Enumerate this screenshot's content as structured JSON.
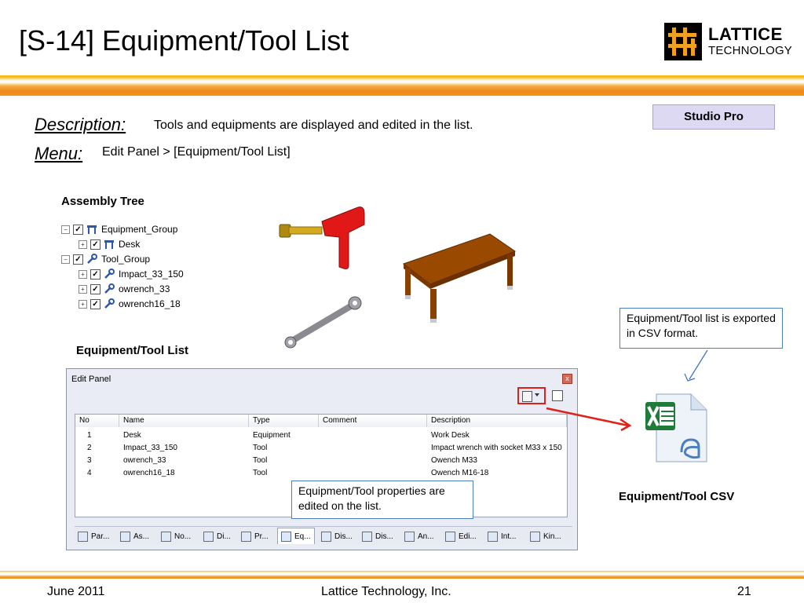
{
  "slide": {
    "title": "[S-14] Equipment/Tool List",
    "logo": {
      "word1": "LATTICE",
      "word2": "TECHNOLOGY"
    },
    "badge": "Studio Pro",
    "description_label": "Description:",
    "description_text": "Tools and equipments are displayed and edited in the list.",
    "menu_label": "Menu:",
    "menu_text": "Edit Panel > [Equipment/Tool List]"
  },
  "assembly_tree": {
    "caption": "Assembly Tree",
    "nodes": [
      {
        "label": "Equipment_Group",
        "icon": "group-icon"
      },
      {
        "label": "Desk",
        "icon": "group-icon"
      },
      {
        "label": "Tool_Group",
        "icon": "wrench-icon"
      },
      {
        "label": "Impact_33_150",
        "icon": "wrench-icon"
      },
      {
        "label": "owrench_33",
        "icon": "wrench-icon"
      },
      {
        "label": "owrench16_18",
        "icon": "wrench-icon"
      }
    ]
  },
  "list_caption": "Equipment/Tool List",
  "edit_panel": {
    "title": "Edit Panel",
    "close_glyph": "x",
    "columns": [
      "No",
      "Name",
      "Type",
      "Comment",
      "Description"
    ],
    "rows": [
      {
        "no": "1",
        "name": "Desk",
        "type": "Equipment",
        "comment": "",
        "description": "Work Desk"
      },
      {
        "no": "2",
        "name": "Impact_33_150",
        "type": "Tool",
        "comment": "",
        "description": "Impact wrench with socket M33 x 150"
      },
      {
        "no": "3",
        "name": "owrench_33",
        "type": "Tool",
        "comment": "",
        "description": "Owench M33"
      },
      {
        "no": "4",
        "name": "owrench16_18",
        "type": "Tool",
        "comment": "",
        "description": "Owench M16-18"
      }
    ],
    "tabs": [
      "Par...",
      "As...",
      "No...",
      "Di...",
      "Pr...",
      "Eq...",
      "Dis...",
      "Dis...",
      "An...",
      "Edi...",
      "Int...",
      "Kin..."
    ],
    "active_tab": "Eq..."
  },
  "callouts": {
    "csv_export": "Equipment/Tool list is exported in CSV format.",
    "edit_on_list": "Equipment/Tool properties are edited on the list."
  },
  "csv_caption": "Equipment/Tool CSV",
  "footer": {
    "date": "June 2011",
    "company": "Lattice Technology, Inc.",
    "page": "21"
  },
  "colors": {
    "accent_orange": "#ef8a1a",
    "badge_bg": "#ddd9f2",
    "highlight_red": "#e0201a",
    "callout_border": "#4a7fc0"
  }
}
